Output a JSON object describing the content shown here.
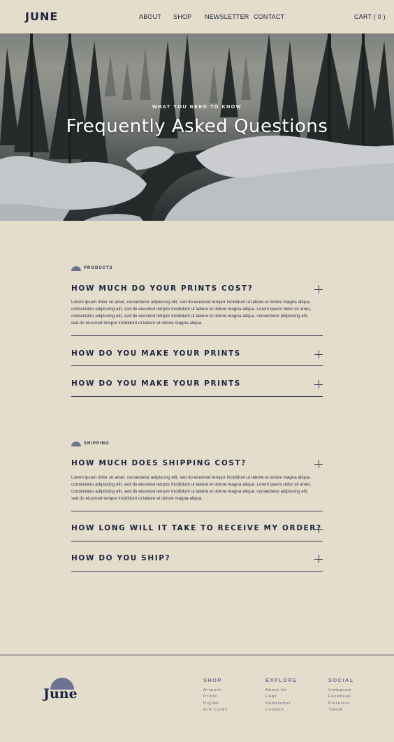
{
  "nav": {
    "logo": "JUNE",
    "links": [
      "ABOUT",
      "SHOP",
      "NEWSLETTER",
      "CONTACT"
    ],
    "cart": "CART ( 0 )"
  },
  "hero": {
    "subtitle": "WHAT YOU NEED TO KNOW",
    "title": "Frequently Asked Questions"
  },
  "sections": [
    {
      "tag": "PRODUCTS",
      "questions": [
        {
          "question": "HOW MUCH DO YOUR PRINTS COST?",
          "answer_lines": [
            "Lorem ipsum dolor sit amet, consectetur adipiscing elit, sed do eiusmod tempor incididunt ut labore et dolore magna aliqua.",
            "consectetur adipiscing elit, sed do eiusmod tempor incididunt ut labore et dolore magna aliqua. Lorem ipsum dolor sit amet,",
            "consectetur adipiscing elit, sed do eiusmod tempor incididunt ut labore et dolore magna aliqua. consectetur adipiscing elit,",
            "sed do eiusmod tempor incididunt ut labore et dolore magna aliqua."
          ]
        },
        {
          "question": "HOW DO YOU MAKE YOUR PRINTS"
        },
        {
          "question": "HOW DO YOU MAKE YOUR PRINTS"
        }
      ]
    },
    {
      "tag": "SHIPPING",
      "questions": [
        {
          "question": "HOW MUCH DOES SHIPPING COST?",
          "answer_lines": [
            "Lorem ipsum dolor sit amet, consectetur adipiscing elit, sed do eiusmod tempor incididunt ut labore et dolore magna aliqua.",
            "consectetur adipiscing elit, sed do eiusmod tempor incididunt ut labore et dolore magna aliqua. Lorem ipsum dolor sit amet,",
            "consectetur adipiscing elit, sed do eiusmod tempor incididunt ut labore et dolore magna aliqua. consectetur adipiscing elit,",
            "sed do eiusmod tempor incididunt ut labore et dolore magna aliqua."
          ]
        },
        {
          "question": "HOW LONG WILL IT TAKE TO RECEIVE MY ORDER?"
        },
        {
          "question": "HOW DO YOU SHIP?"
        }
      ]
    }
  ],
  "footer": {
    "logo": "June",
    "columns": [
      {
        "heading": "SHOP",
        "links": [
          "Artwork",
          "Prints",
          "Digital",
          "Gift Cards"
        ]
      },
      {
        "heading": "EXPLORE",
        "links": [
          "About Us",
          "Faqs",
          "Newsletter",
          "Contact"
        ]
      },
      {
        "heading": "SOCIAL",
        "links": [
          "Instagram",
          "Facebook",
          "Pinterest",
          "Tiktok"
        ]
      }
    ]
  },
  "colors": {
    "background": "#e4ddcc",
    "ink": "#1f2440",
    "accent": "#6b7390"
  },
  "icons": [
    "plus-icon",
    "half-circle-icon"
  ]
}
